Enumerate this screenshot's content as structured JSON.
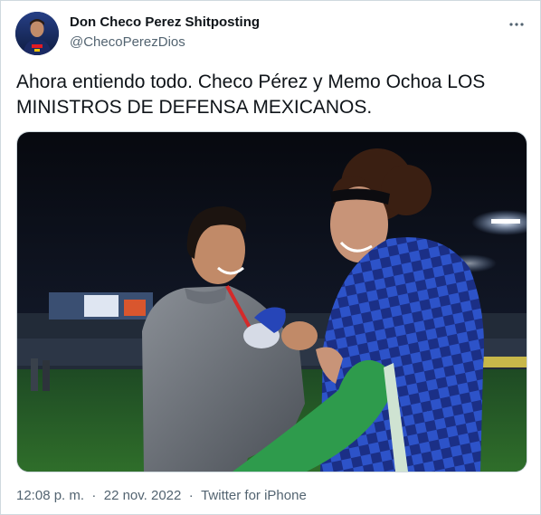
{
  "author": {
    "name": "Don Checo Perez Shitposting",
    "handle": "@ChecoPerezDios",
    "avatar_icon": "avatar-racing-driver"
  },
  "more_icon": "more-horizontal-icon",
  "tweet": {
    "text": "Ahora entiendo todo. Checo Pérez y Memo Ochoa LOS MINISTROS DE DEFENSA MEXICANOS."
  },
  "media": {
    "kind": "photo"
  },
  "meta": {
    "time": "12:08 p. m.",
    "separator": "·",
    "date": "22 nov. 2022",
    "source": "Twitter for iPhone"
  },
  "colors": {
    "text_primary": "#0f1419",
    "text_secondary": "#536471",
    "border": "#cfd9de"
  }
}
